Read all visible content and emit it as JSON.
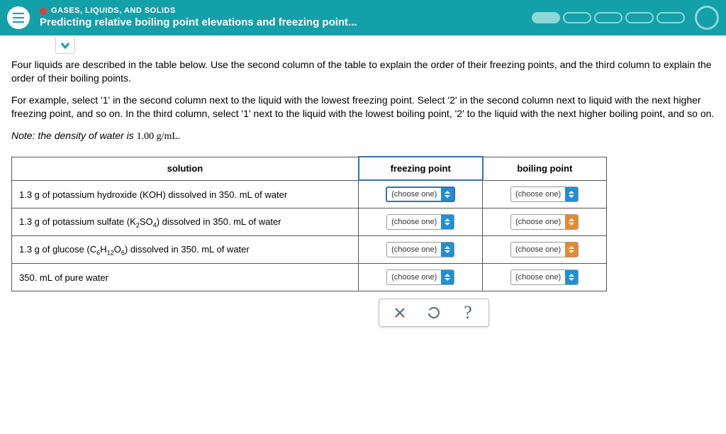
{
  "header": {
    "breadcrumb": "GASES, LIQUIDS, AND SOLIDS",
    "title": "Predicting relative boiling point elevations and freezing point..."
  },
  "instructions": {
    "p1": "Four liquids are described in the table below. Use the second column of the table to explain the order of their freezing points, and the third column to explain the order of their boiling points.",
    "p2": "For example, select '1' in the second column next to the liquid with the lowest freezing point. Select '2' in the second column next to liquid with the next higher freezing point, and so on. In the third column, select '1' next to the liquid with the lowest boiling point, '2' to the liquid with the next higher boiling point, and so on.",
    "note_prefix": "Note:",
    "note_text": " the density of water is ",
    "density": "1.00 g/mL",
    "note_tail": "."
  },
  "table": {
    "col_solution": "solution",
    "col_fp": "freezing point",
    "col_bp": "boiling point",
    "dd_placeholder": "(choose one)",
    "rows": [
      {
        "text_a": "1.3 g of potassium hydroxide (KOH) dissolved in 350. mL of water"
      },
      {
        "text_b_pre": "1.3 g of potassium sulfate (K",
        "text_b_mid": "SO",
        "text_b_post": ") dissolved in 350. mL of water"
      },
      {
        "text_c_pre": "1.3 g of glucose (C",
        "text_c_h": "H",
        "text_c_o": "O",
        "text_c_post": ") dissolved in 350. mL of water"
      },
      {
        "text_d": "350. mL of pure water"
      }
    ]
  },
  "controls": {
    "clear": "clear",
    "reset": "reset",
    "help": "?"
  }
}
